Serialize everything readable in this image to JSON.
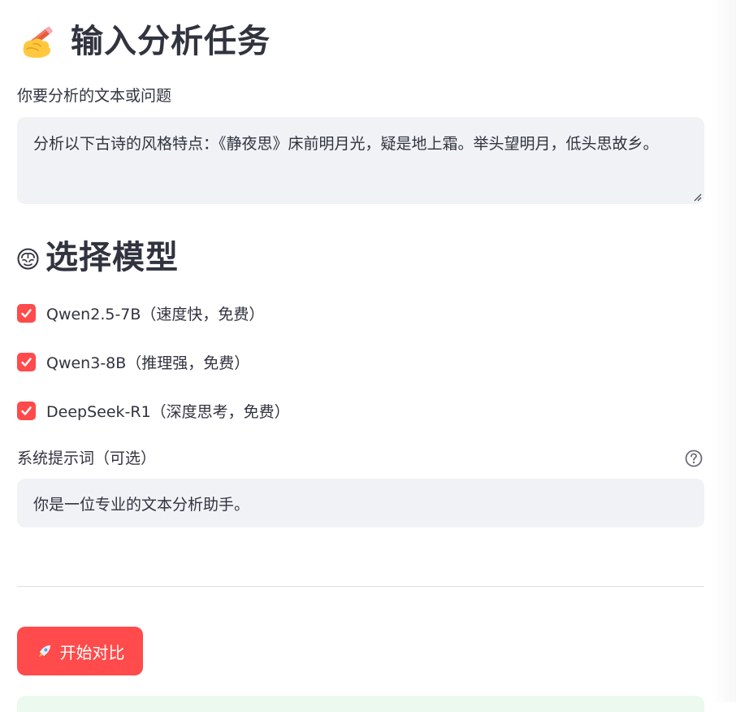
{
  "task_section": {
    "title": "输入分析任务",
    "emoji": "writing-hand-icon",
    "input_label": "你要分析的文本或问题",
    "input_value": "分析以下古诗的风格特点：《静夜思》床前明月光，疑是地上霜。举头望明月，低头思故乡。"
  },
  "model_section": {
    "title": "选择模型",
    "emoji": "brain-icon",
    "models": [
      {
        "label": "Qwen2.5-7B（速度快，免费）",
        "checked": true
      },
      {
        "label": "Qwen3-8B（推理强，免费）",
        "checked": true
      },
      {
        "label": "DeepSeek-R1（深度思考，免费）",
        "checked": true
      }
    ]
  },
  "system_prompt": {
    "label": "系统提示词（可选）",
    "value": "你是一位专业的文本分析助手。",
    "help_icon": "question-circle-icon"
  },
  "actions": {
    "start_label": "开始对比",
    "start_icon": "rocket-icon"
  },
  "colors": {
    "primary": "#ff4b4b",
    "text": "#31333f",
    "input_bg": "#f0f2f6",
    "success_bg": "#ebf9ee"
  }
}
